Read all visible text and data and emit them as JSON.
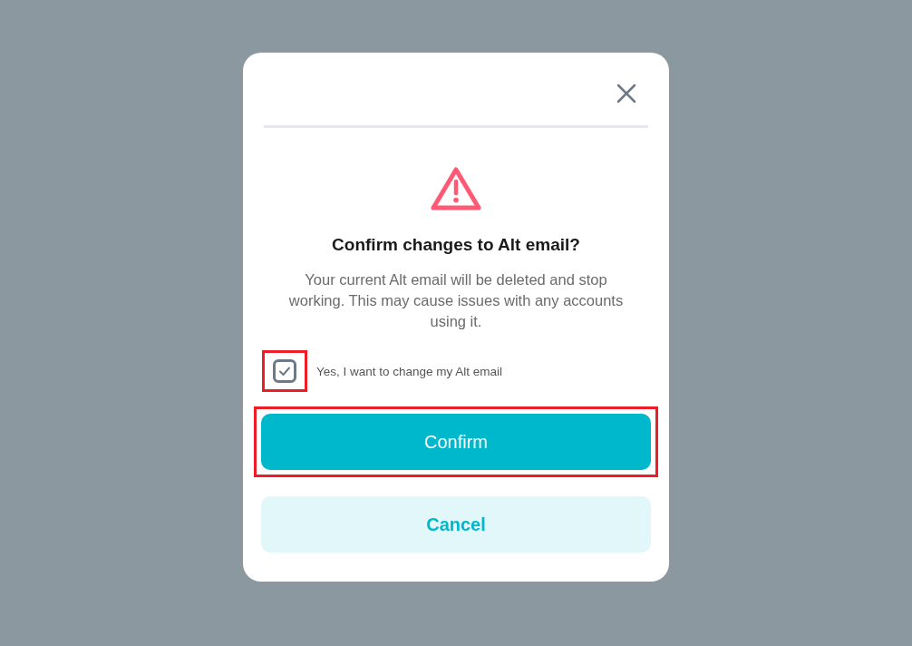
{
  "dialog": {
    "title": "Confirm changes to Alt email?",
    "message": "Your current Alt email will be deleted and stop working. This may cause issues with any accounts using it.",
    "checkbox": {
      "label": "Yes, I want to change my Alt email",
      "checked": true,
      "highlighted": true
    },
    "buttons": [
      {
        "label": "Confirm",
        "kind": "primary",
        "highlighted": true
      },
      {
        "label": "Cancel",
        "kind": "secondary",
        "highlighted": false
      }
    ]
  }
}
